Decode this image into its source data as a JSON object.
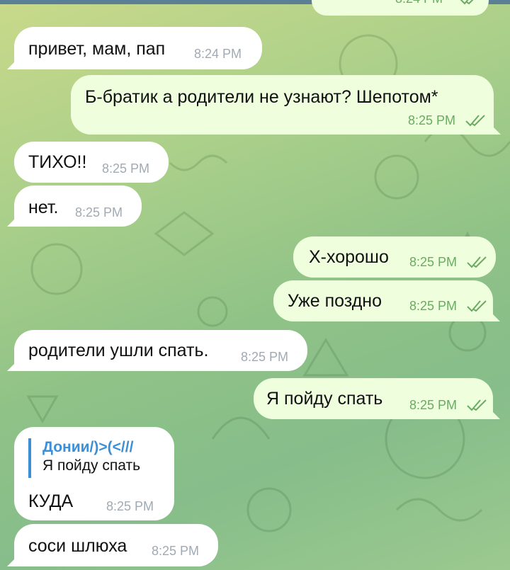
{
  "chat": {
    "top_partial": {
      "time": "8:24 PM"
    },
    "messages": [
      {
        "text": "привет, мам, пап",
        "time": "8:24 PM"
      },
      {
        "text": "Б-братик а родители не узнают? Шепотом*",
        "time": "8:25 PM"
      },
      {
        "text": "ТИХО!!",
        "time": "8:25 PM"
      },
      {
        "text": "нет.",
        "time": "8:25 PM"
      },
      {
        "text": "Х-хорошо",
        "time": "8:25 PM"
      },
      {
        "text": "Уже поздно",
        "time": "8:25 PM"
      },
      {
        "text": "родители ушли спать.",
        "time": "8:25 PM"
      },
      {
        "text": "Я пойду спать",
        "time": "8:25 PM"
      },
      {
        "text": "КУДА",
        "time": "8:25 PM",
        "reply_name": "Донии/)>(<///",
        "reply_text": "Я пойду спать"
      },
      {
        "text": "соси шлюха",
        "time": "8:25 PM"
      }
    ]
  },
  "colors": {
    "incoming_bubble": "#ffffff",
    "outgoing_bubble": "#effedd",
    "outgoing_meta": "#6aab62",
    "incoming_meta": "#a1aab3",
    "reply_accent": "#3b8fd6"
  }
}
